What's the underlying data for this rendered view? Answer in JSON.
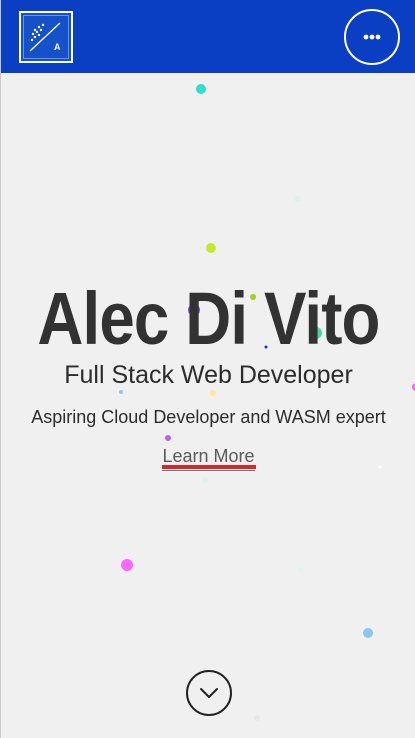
{
  "header": {
    "logo_letter": "A",
    "background": "#0a3fc4",
    "menu_icon": "ellipsis-icon"
  },
  "hero": {
    "name": "Alec Di Vito",
    "title": "Full Stack Web Developer",
    "subtitle": "Aspiring Cloud Developer and WASM expert",
    "cta_label": "Learn More",
    "cta_underline_color": "#d9262c",
    "scroll_icon": "chevron-down-icon"
  },
  "particles": {
    "colors": [
      "#2fe0c8",
      "#c8e836",
      "#a86bf0",
      "#4bd6a0",
      "#7a4de0",
      "#ff66ff",
      "#8ac8f0",
      "#ffe9a0",
      "#1a2fd0",
      "#9fe8d8"
    ]
  }
}
